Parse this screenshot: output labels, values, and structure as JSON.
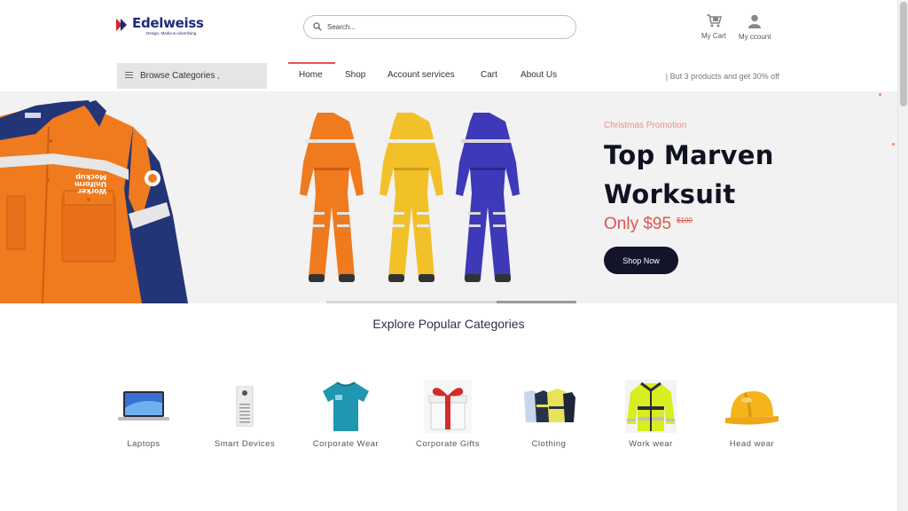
{
  "brand": {
    "name": "Edelweiss",
    "tagline": "Design, Media & Advertising"
  },
  "search": {
    "placeholder": "Search..."
  },
  "header_actions": {
    "cart": "My Cart",
    "account": "My ccount"
  },
  "nav": {
    "browse_label": "Browse Categories",
    "items": [
      "Home",
      "Shop",
      "Account services",
      "Cart",
      "About Us"
    ],
    "promo": "| But 3 products and get 30% off"
  },
  "hero": {
    "label": "Christmas Promotion",
    "title": "Top Marven Worksuit",
    "price": "Only $95",
    "old_price": "$100",
    "button": "Shop Now",
    "jacket_print": [
      "Worker",
      "Uniform",
      "Mockup"
    ],
    "slider_progress": 1.0,
    "colors": {
      "orange": "#f07a1e",
      "yellow": "#f2c12a",
      "blue": "#3d39b8",
      "navy": "#233577",
      "accent": "#e2534f",
      "dark": "#13142a"
    }
  },
  "categories": {
    "title": "Explore Popular Categories",
    "items": [
      {
        "name": "Laptops",
        "icon": "laptop-icon"
      },
      {
        "name": "Smart Devices",
        "icon": "air-purifier-icon"
      },
      {
        "name": "Corporate Wear",
        "icon": "tshirt-icon"
      },
      {
        "name": "Corporate Gifts",
        "icon": "gift-box-icon"
      },
      {
        "name": "Clothing",
        "icon": "jackets-icon"
      },
      {
        "name": "Work wear",
        "icon": "hi-vis-jacket-icon"
      },
      {
        "name": "Head wear",
        "icon": "hard-hat-icon"
      }
    ]
  }
}
